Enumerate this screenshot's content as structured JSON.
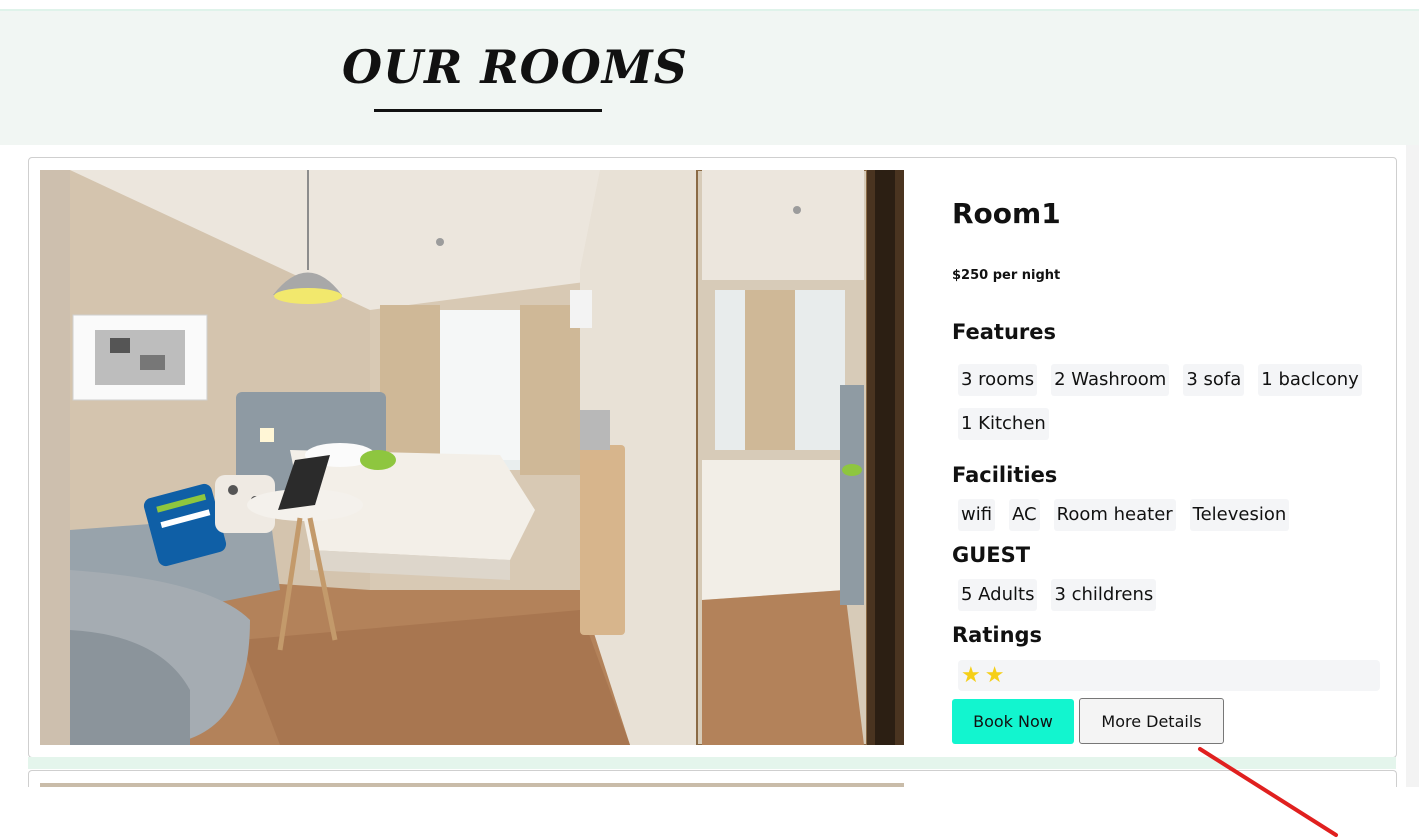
{
  "page": {
    "title": "OUR ROOMS"
  },
  "room": {
    "name": "Room1",
    "price": "$250 per night",
    "features_label": "Features",
    "features": [
      "3 rooms",
      "2 Washroom",
      "3 sofa",
      "1 baclcony",
      "1 Kitchen"
    ],
    "facilities_label": "Facilities",
    "facilities": [
      "wifi",
      "AC",
      "Room heater",
      "Televesion"
    ],
    "guest_label": "GUEST",
    "guests": [
      "5 Adults",
      "3 childrens"
    ],
    "ratings_label": "Ratings",
    "rating_stars": 2,
    "book_label": "Book Now",
    "details_label": "More Details"
  },
  "colors": {
    "accent": "#12f5cf",
    "star": "#f5cf18",
    "annotation_arrow": "#e0201f"
  },
  "icons": [
    "star-icon"
  ]
}
